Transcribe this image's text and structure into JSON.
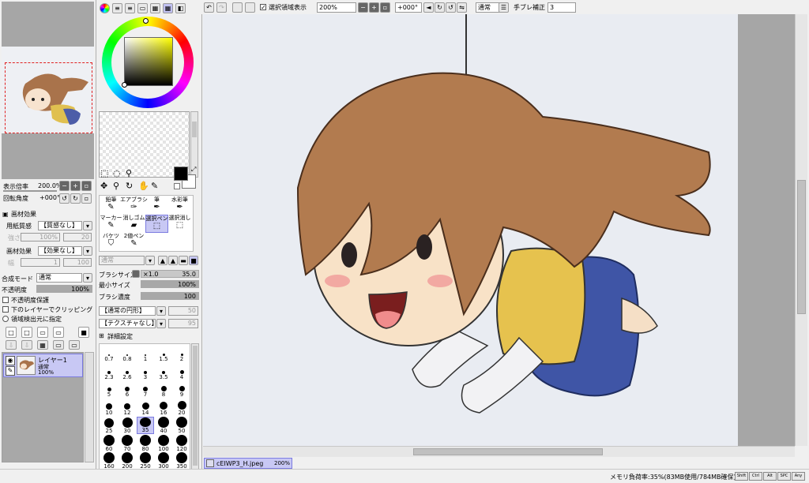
{
  "toolbar": {
    "selection_visible_label": "選択領域表示",
    "zoom": "200%",
    "rotation": "+000°",
    "blend": "通常",
    "stabilizer_label": "手ブレ補正",
    "stabilizer": "3"
  },
  "navigator": {
    "zoom_label": "表示倍率",
    "zoom_value": "200.0%",
    "rotate_label": "回転角度",
    "rotate_value": "+000°"
  },
  "texture": {
    "header": "画材効果",
    "paper_label": "用紙質感",
    "paper_value": "【質感なし】",
    "paper_strength_label": "強さ",
    "paper_strength_value": "100%",
    "paper_scale_value": "20",
    "effect_label": "画材効果",
    "effect_value": "【効果なし】",
    "effect_width_label": "幅",
    "effect_width_value": "1",
    "effect_strength_value": "100"
  },
  "layer": {
    "mode_label": "合成モード",
    "mode_value": "通常",
    "opacity_label": "不透明度",
    "opacity_value": "100%",
    "protect_label": "不透明度保護",
    "clip_label": "下のレイヤーでクリッピング",
    "select_source_label": "領域検出元に指定",
    "items": [
      {
        "name": "レイヤー1",
        "mode": "通常",
        "opacity": "100%"
      }
    ]
  },
  "tools": [
    {
      "label": "鉛筆",
      "icon": "pencil-icon"
    },
    {
      "label": "エアブラシ",
      "icon": "airbrush-icon"
    },
    {
      "label": "筆",
      "icon": "brush-icon"
    },
    {
      "label": "水彩筆",
      "icon": "watercolor-icon"
    },
    {
      "label": "マーカー",
      "icon": "marker-icon"
    },
    {
      "label": "消しゴム",
      "icon": "eraser-icon"
    },
    {
      "label": "選択ペン",
      "icon": "select-pen-icon"
    },
    {
      "label": "選択消し",
      "icon": "select-erase-icon"
    },
    {
      "label": "バケツ",
      "icon": "bucket-icon"
    },
    {
      "label": "2値ペン",
      "icon": "binary-pen-icon"
    }
  ],
  "brush": {
    "blend_value": "通常",
    "size_label": "ブラシサイズ",
    "size_mult": "×1.0",
    "size_value": "35.0",
    "min_size_label": "最小サイズ",
    "min_size_value": "100%",
    "density_label": "ブラシ濃度",
    "density_value": "100",
    "shape_value": "【通常の円形】",
    "shape_num": "50",
    "texture_value": "【テクスチャなし】",
    "texture_num": "95",
    "detail_label": "詳細設定",
    "min_size_fill": 1.0,
    "density_fill": 1.0,
    "sizes": [
      "0.7",
      "0.8",
      "1",
      "1.5",
      "2",
      "2.3",
      "2.6",
      "3",
      "3.5",
      "4",
      "5",
      "6",
      "7",
      "8",
      "9",
      "10",
      "12",
      "14",
      "16",
      "20",
      "25",
      "30",
      "35",
      "40",
      "50",
      "60",
      "70",
      "80",
      "100",
      "120",
      "160",
      "200",
      "250",
      "300",
      "350"
    ],
    "selected_size": "35"
  },
  "file_tab": {
    "name": "cEIWP3_H.jpeg",
    "zoom": "200%"
  },
  "status": {
    "memory": "メモリ負荷率:35%(83MB使用/784MB確保)",
    "keys": [
      "Shift",
      "Ctrl",
      "Alt",
      "SPC",
      "Any"
    ]
  },
  "colors": {
    "accent": "#b8b8f0",
    "hair": "#b07a4e",
    "canvas_bg": "#e9ecf2"
  }
}
